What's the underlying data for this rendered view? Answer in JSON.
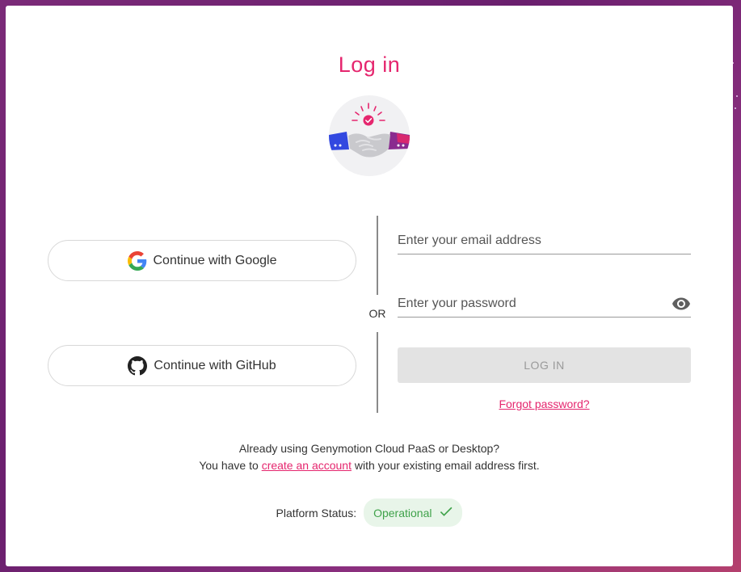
{
  "title": "Log in",
  "social": {
    "google_label": "Continue with Google",
    "github_label": "Continue with GitHub"
  },
  "divider": {
    "or": "OR"
  },
  "form": {
    "email_placeholder": "Enter your email address",
    "email_value": "",
    "password_placeholder": "Enter your password",
    "password_value": "",
    "login_label": "LOG IN",
    "forgot_label": "Forgot password?"
  },
  "info": {
    "line1": "Already using Genymotion Cloud PaaS or Desktop?",
    "line2_prefix": "You have to",
    "line2_link": "create an account",
    "line2_suffix": "with your existing email address first."
  },
  "status": {
    "label": "Platform Status:",
    "value": "Operational"
  },
  "icons": {
    "google": "google-icon",
    "github": "github-icon",
    "eye": "eye-icon",
    "check": "check-icon",
    "hero": "handshake-illustration"
  },
  "colors": {
    "accent": "#e5266e",
    "status_green": "#3fa24a",
    "status_bg": "#e8f5e9",
    "disabled_btn": "#e3e3e3"
  }
}
